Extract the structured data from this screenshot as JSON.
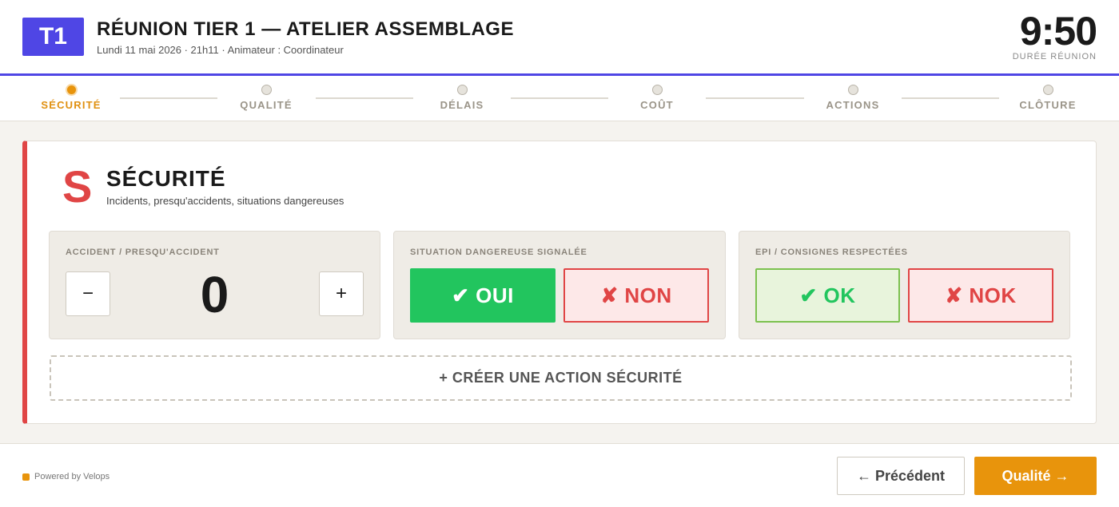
{
  "header": {
    "badge": "T1",
    "title": "RÉUNION TIER 1 — ATELIER ASSEMBLAGE",
    "subtitle": "Lundi 11 mai 2026 · 21h11 · Animateur : Coordinateur",
    "timer": "9:50",
    "timer_label": "DURÉE RÉUNION"
  },
  "steps": [
    {
      "label": "SÉCURITÉ",
      "active": true
    },
    {
      "label": "QUALITÉ",
      "active": false
    },
    {
      "label": "DÉLAIS",
      "active": false
    },
    {
      "label": "COÛT",
      "active": false
    },
    {
      "label": "ACTIONS",
      "active": false
    },
    {
      "label": "CLÔTURE",
      "active": false
    }
  ],
  "section": {
    "letter": "S",
    "title": "SÉCURITÉ",
    "subtitle": "Incidents, presqu'accidents, situations dangereuses",
    "accent_color": "#e04545",
    "accident": {
      "label": "ACCIDENT / PRESQU'ACCIDENT",
      "value": "0",
      "minus": "−",
      "plus": "+"
    },
    "danger": {
      "label": "SITUATION DANGEREUSE SIGNALÉE",
      "yes": "✔ OUI",
      "no": "✘ NON",
      "selected": "yes"
    },
    "ppe": {
      "label": "EPI / CONSIGNES RESPECTÉES",
      "ok": "✔ OK",
      "nok": "✘ NOK"
    },
    "add_action": "+ CRÉER UNE ACTION SÉCURITÉ"
  },
  "footer": {
    "powered": "Powered by Velops",
    "prev": "← Précédent",
    "next": "Qualité →"
  },
  "colors": {
    "brand": "#4f46e5",
    "accent": "#e8940c",
    "success": "#22c55e",
    "danger": "#e04545"
  }
}
